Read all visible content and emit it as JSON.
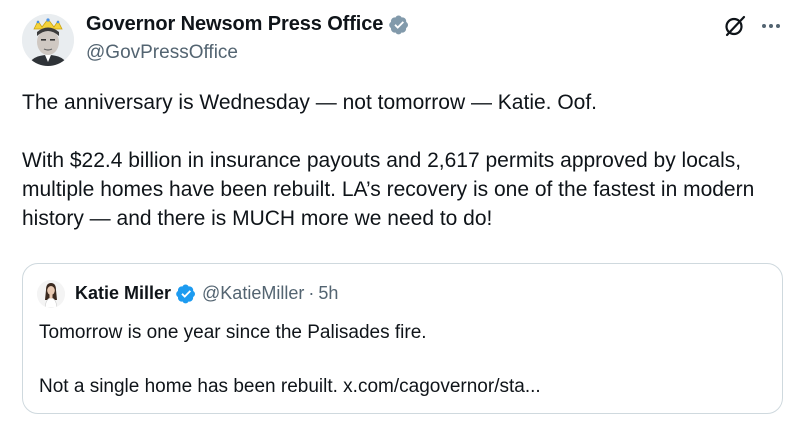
{
  "author": {
    "display_name": "Governor Newsom Press Office",
    "handle": "@GovPressOffice",
    "badge": "gray-verified-badge"
  },
  "tweet": {
    "paragraph_1": "The anniversary is Wednesday — not tomorrow — Katie. Oof.",
    "paragraph_2": "With $22.4 billion in insurance payouts and 2,617 permits approved by locals, multiple homes have been rebuilt. LA’s recovery is one of the fastest in modern history — and there is MUCH more we need to do!"
  },
  "quoted": {
    "display_name": "Katie Miller",
    "handle": "@KatieMiller",
    "separator": "·",
    "time": "5h",
    "badge": "blue-verified-badge",
    "paragraph_1": "Tomorrow is one year since the Palisades fire.",
    "paragraph_2": "Not a single home has been rebuilt. x.com/cagovernor/sta..."
  },
  "icons": {
    "grok": "grok-icon",
    "more": "more-options-icon"
  },
  "colors": {
    "text": "#0f1419",
    "secondary": "#536471",
    "border": "#cfd9de",
    "gov_badge": "#829aab",
    "blue_badge": "#1d9bf0"
  }
}
